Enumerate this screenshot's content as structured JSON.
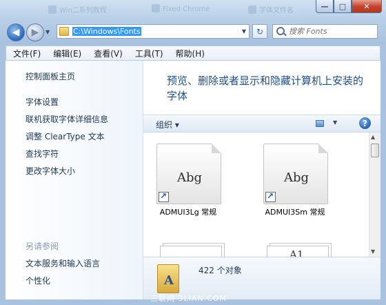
{
  "titlebar": {
    "tabs": [
      "Win二系列教程",
      "Fixed Chrome",
      "字体文件名"
    ],
    "minimize": "0",
    "maximize": "1",
    "close": "r"
  },
  "nav": {
    "back_glyph": "◀",
    "forward_glyph": "▶",
    "address": "C:\\Windows\\Fonts",
    "refresh_glyph": "↻",
    "search_placeholder": "搜索 Fonts"
  },
  "menubar": {
    "items": [
      "文件(F)",
      "编辑(E)",
      "查看(V)",
      "工具(T)",
      "帮助(H)"
    ]
  },
  "leftpane": {
    "home": "控制面板主页",
    "links": [
      "字体设置",
      "联机获取字体详细信息",
      "调整 ClearType 文本",
      "查找字符",
      "更改字体大小"
    ],
    "see_also": "另请参阅",
    "see_also_links": [
      "文本服务和输入语言",
      "个性化"
    ]
  },
  "main": {
    "heading": "预览、删除或者显示和隐藏计算机上安装的字体",
    "organize": "组织 ▾",
    "help": "?",
    "fonts": [
      {
        "preview": "Abg",
        "name": "ADMUI3Lg 常规"
      },
      {
        "preview": "Abg",
        "name": "ADMUI3Sm 常规"
      }
    ],
    "partial_preview": "A1",
    "status": "422 个对象"
  },
  "watermark": {
    "text": "三联网 3LIAN.COM"
  }
}
